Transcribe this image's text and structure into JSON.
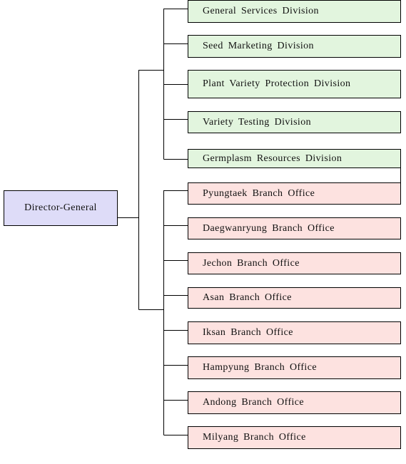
{
  "director": {
    "label": "Director-General"
  },
  "divisions": [
    {
      "label": "General Services Division"
    },
    {
      "label": "Seed Marketing Division"
    },
    {
      "label": "Plant Variety Protection Division"
    },
    {
      "label": "Variety Testing Division"
    },
    {
      "label": "Germplasm Resources Division"
    }
  ],
  "branch_offices": [
    {
      "label": "Pyungtaek Branch Office"
    },
    {
      "label": "Daegwanryung Branch Office"
    },
    {
      "label": "Jechon Branch Office"
    },
    {
      "label": "Asan Branch Office"
    },
    {
      "label": "Iksan Branch Office"
    },
    {
      "label": "Hampyung Branch Office"
    },
    {
      "label": "Andong Branch Office"
    },
    {
      "label": "Milyang Branch Office"
    }
  ],
  "colors": {
    "director": "#dedcf8",
    "division": "#e2f5de",
    "branch_office": "#fde2e0"
  }
}
